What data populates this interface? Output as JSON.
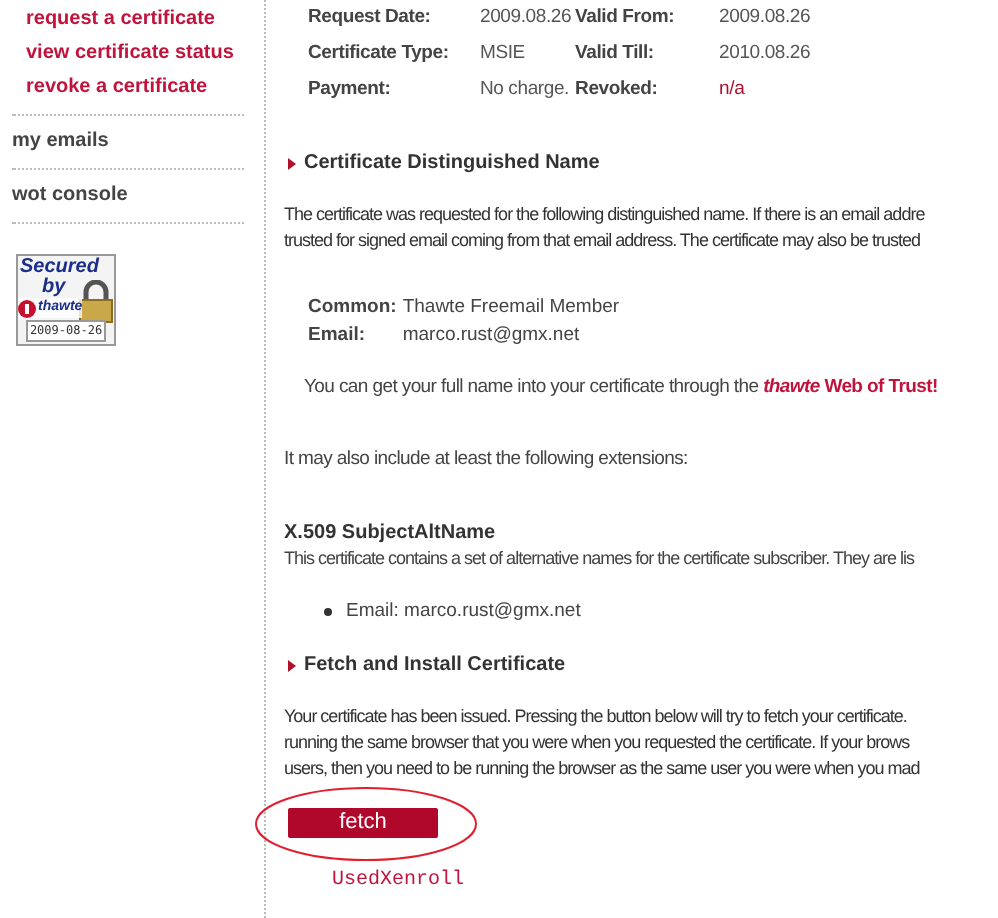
{
  "sidebar": {
    "sub_links": [
      "request a certificate",
      "view certificate status",
      "revoke a certificate"
    ],
    "items": [
      "my emails",
      "wot console"
    ],
    "seal": {
      "line_1": "Secured",
      "line_2": "by",
      "brand": "thawte",
      "date": "2009-08-26"
    }
  },
  "details": [
    {
      "label": "Request Date:",
      "value": "2009.08.26",
      "label_2": "Valid From:",
      "value_2": "2009.08.26"
    },
    {
      "label": "Certificate Type:",
      "value": "MSIE",
      "label_2": "Valid Till:",
      "value_2": "2010.08.26"
    },
    {
      "label": "Payment:",
      "value": "No charge.",
      "label_2": "Revoked:",
      "value_2": "n/a"
    }
  ],
  "dn_section": {
    "heading": "Certificate Distinguished Name",
    "paragraph_lines": [
      "The certificate was requested for the following distinguished name. If there is an email addre",
      "trusted for signed email coming from that email address. The certificate may also be trusted"
    ],
    "fields": [
      {
        "label": "Common:",
        "value": "Thawte Freemail Member"
      },
      {
        "label": "Email:",
        "value": "marco.rust@gmx.net"
      }
    ],
    "wot_note": "You can get your full name into your certificate through the ",
    "wot_link": "*thawte* Web of Trust!",
    "extensions_intro": "It may also include at least the following extensions:",
    "ext_title": "X.509 SubjectAltName",
    "ext_text": "This certificate contains a set of alternative names for the certificate subscriber. They are lis",
    "ext_items": [
      "Email: marco.rust@gmx.net"
    ]
  },
  "fetch_section": {
    "heading": "Fetch and Install Certificate",
    "paragraph_lines": [
      "Your certificate has been issued. Pressing the button below will try to fetch your certificate.",
      "running the same browser that you were when you requested the certificate. If your brows",
      "users, then you need to be running the browser as the same user you were when you mad"
    ],
    "button": "fetch",
    "note": "UsedXenroll"
  }
}
